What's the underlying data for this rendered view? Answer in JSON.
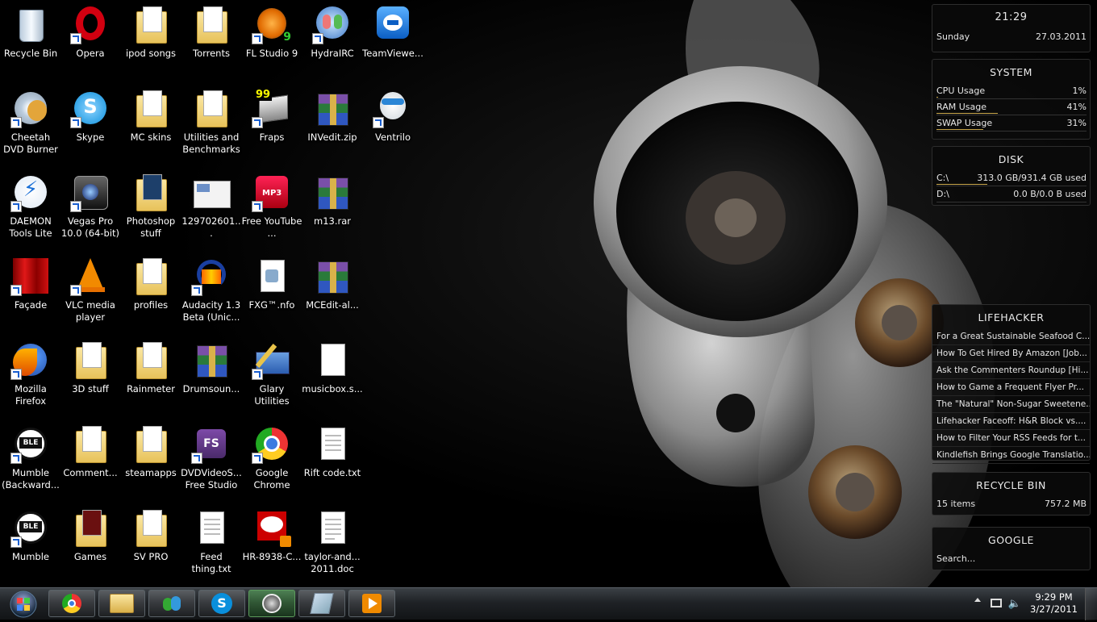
{
  "desktop": {
    "icons": [
      {
        "label": "Recycle Bin"
      },
      {
        "label": "Opera"
      },
      {
        "label": "ipod songs"
      },
      {
        "label": "Torrents"
      },
      {
        "label": "FL Studio 9"
      },
      {
        "label": "HydraIRC"
      },
      {
        "label": "TeamViewe..."
      },
      {
        "label": "Cheetah DVD Burner"
      },
      {
        "label": "Skype"
      },
      {
        "label": "MC skins"
      },
      {
        "label": "Utilities and Benchmarks"
      },
      {
        "label": "Fraps"
      },
      {
        "label": "INVedit.zip"
      },
      {
        "label": "Ventrilo"
      },
      {
        "label": "DAEMON Tools Lite"
      },
      {
        "label": "Vegas Pro 10.0 (64-bit)"
      },
      {
        "label": "Photoshop stuff"
      },
      {
        "label": "129702601..."
      },
      {
        "label": "Free YouTube ..."
      },
      {
        "label": "m13.rar"
      },
      {
        "label": "Façade"
      },
      {
        "label": "VLC media player"
      },
      {
        "label": "profiles"
      },
      {
        "label": "Audacity 1.3 Beta (Unic..."
      },
      {
        "label": "FXG™.nfo"
      },
      {
        "label": "MCEdit-al..."
      },
      {
        "label": "Mozilla Firefox"
      },
      {
        "label": "3D stuff"
      },
      {
        "label": "Rainmeter"
      },
      {
        "label": "Drumsoun..."
      },
      {
        "label": "Glary Utilities"
      },
      {
        "label": "musicbox.s..."
      },
      {
        "label": "Mumble (Backward..."
      },
      {
        "label": "Comment..."
      },
      {
        "label": "steamapps"
      },
      {
        "label": "DVDVideoS... Free Studio"
      },
      {
        "label": "Google Chrome"
      },
      {
        "label": "Rift code.txt"
      },
      {
        "label": "Mumble"
      },
      {
        "label": "Games"
      },
      {
        "label": "SV PRO"
      },
      {
        "label": "Feed thing.txt"
      },
      {
        "label": "HR-8938-C..."
      },
      {
        "label": "taylor-and... 2011.doc"
      }
    ],
    "badges": {
      "fl_studio": "9",
      "fraps": "99",
      "dvdvideo": "FS"
    }
  },
  "gadgets": {
    "clock": {
      "time": "21:29",
      "day": "Sunday",
      "date": "27.03.2011"
    },
    "system": {
      "title": "SYSTEM",
      "rows": [
        {
          "label": "CPU Usage",
          "value": "1%",
          "pct": 1
        },
        {
          "label": "RAM Usage",
          "value": "41%",
          "pct": 41
        },
        {
          "label": "SWAP Usage",
          "value": "31%",
          "pct": 31
        }
      ]
    },
    "disk": {
      "title": "DISK",
      "rows": [
        {
          "label": "C:\\",
          "value": "313.0 GB/931.4 GB used",
          "pct": 34
        },
        {
          "label": "D:\\",
          "value": "0.0 B/0.0 B used",
          "pct": 0
        }
      ]
    },
    "lifehacker": {
      "title": "LIFEHACKER",
      "items": [
        "For a Great Sustainable Seafood C...",
        "How To Get Hired By Amazon [Job...",
        "Ask the Commenters Roundup [Hi...",
        "How to Game a Frequent Flyer Pr...",
        "The \"Natural\" Non-Sugar Sweetene...",
        "Lifehacker Faceoff: H&R Block vs....",
        "How to Filter Your RSS Feeds for t...",
        "Kindlefish Brings Google Translatio..."
      ]
    },
    "recycle": {
      "title": "RECYCLE BIN",
      "items": "15 items",
      "size": "757.2 MB"
    },
    "google": {
      "title": "GOOGLE",
      "placeholder": "Search..."
    }
  },
  "taskbar": {
    "clock_time": "9:29 PM",
    "clock_date": "3/27/2011",
    "pinned": [
      "chrome-icon",
      "explorer-icon",
      "messenger-icon",
      "skype-icon",
      "steam-icon",
      "notepad-icon",
      "media-player-icon"
    ]
  },
  "colors": {
    "accent": "#c8a64a",
    "taskbar": "#1f2226",
    "steam_active": "#3f8f3f"
  }
}
